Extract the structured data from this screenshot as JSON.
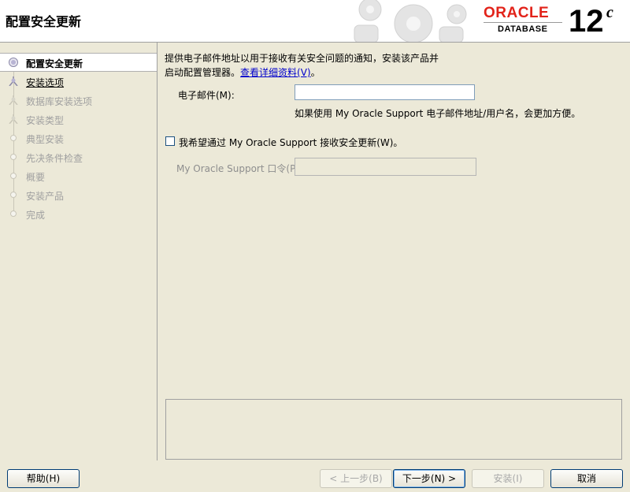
{
  "window": {
    "title": "配置安全更新"
  },
  "branding": {
    "oracle": "ORACLE",
    "database": "DATABASE",
    "version": "12",
    "version_suffix": "c"
  },
  "colors": {
    "brand_red": "#E2231A",
    "link_blue": "#0000CC"
  },
  "steps": [
    {
      "label": "配置安全更新",
      "state": "active"
    },
    {
      "label": "安装选项",
      "state": "link"
    },
    {
      "label": "数据库安装选项",
      "state": "disabled"
    },
    {
      "label": "安装类型",
      "state": "disabled"
    },
    {
      "label": "典型安装",
      "state": "disabled"
    },
    {
      "label": "先决条件检查",
      "state": "disabled"
    },
    {
      "label": "概要",
      "state": "disabled"
    },
    {
      "label": "安装产品",
      "state": "disabled"
    },
    {
      "label": "完成",
      "state": "disabled"
    }
  ],
  "content": {
    "description_line1": "提供电子邮件地址以用于接收有关安全问题的通知，安装该产品并",
    "description_line2": "启动配置管理器。",
    "details_link": "查看详细资料(V)",
    "description_end": "。",
    "email_label": "电子邮件(M):",
    "email_value": "",
    "email_hint": "如果使用 My Oracle Support 电子邮件地址/用户名，会更加方便。",
    "checkbox_label": "我希望通过 My Oracle Support 接收安全更新(W)。",
    "checkbox_checked": false,
    "password_label": "My Oracle Support 口令(P):",
    "password_value": ""
  },
  "buttons": {
    "help": "帮助(H)",
    "back": "< 上一步(B)",
    "next": "下一步(N) >",
    "install": "安装(I)",
    "cancel": "取消"
  }
}
